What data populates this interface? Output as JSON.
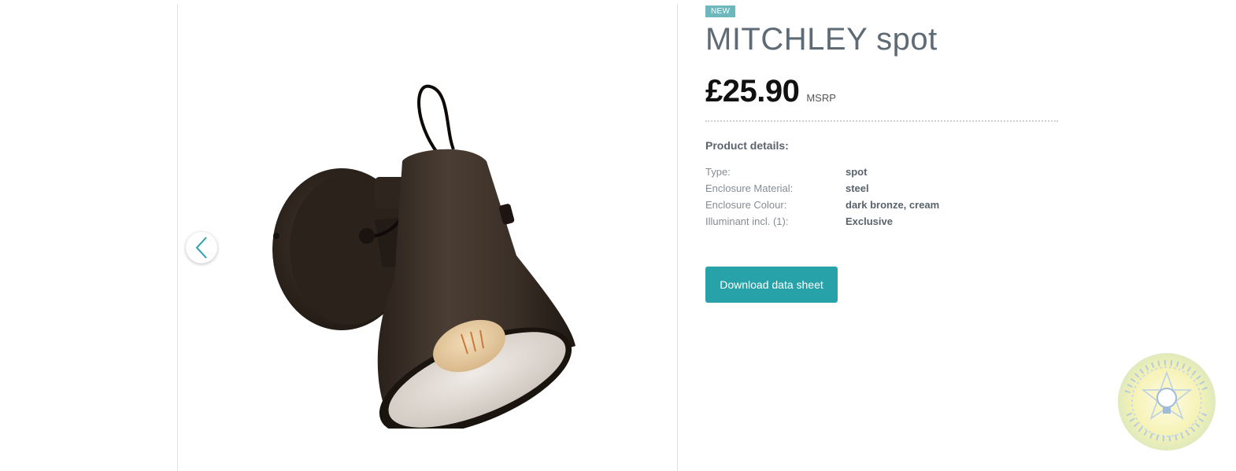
{
  "product": {
    "badge": "NEW",
    "title": "MITCHLEY spot",
    "price": "£25.90",
    "price_suffix": "MSRP",
    "details_heading": "Product details:",
    "details": [
      {
        "key": "Type:",
        "value": "spot"
      },
      {
        "key": "Enclosure Material:",
        "value": "steel"
      },
      {
        "key": "Enclosure Colour:",
        "value": "dark bronze, cream"
      },
      {
        "key": "Illuminant incl. (1):",
        "value": "Exclusive"
      }
    ],
    "download_label": "Download data sheet"
  },
  "gallery": {
    "prev_icon": "chevron-left-icon"
  },
  "watermark": {
    "text": "led light in your life   www.ultled.com.ua"
  },
  "colors": {
    "accent": "#26a2a8",
    "badge": "#6cb8bd",
    "title": "#5f6b74",
    "price": "#111111"
  }
}
